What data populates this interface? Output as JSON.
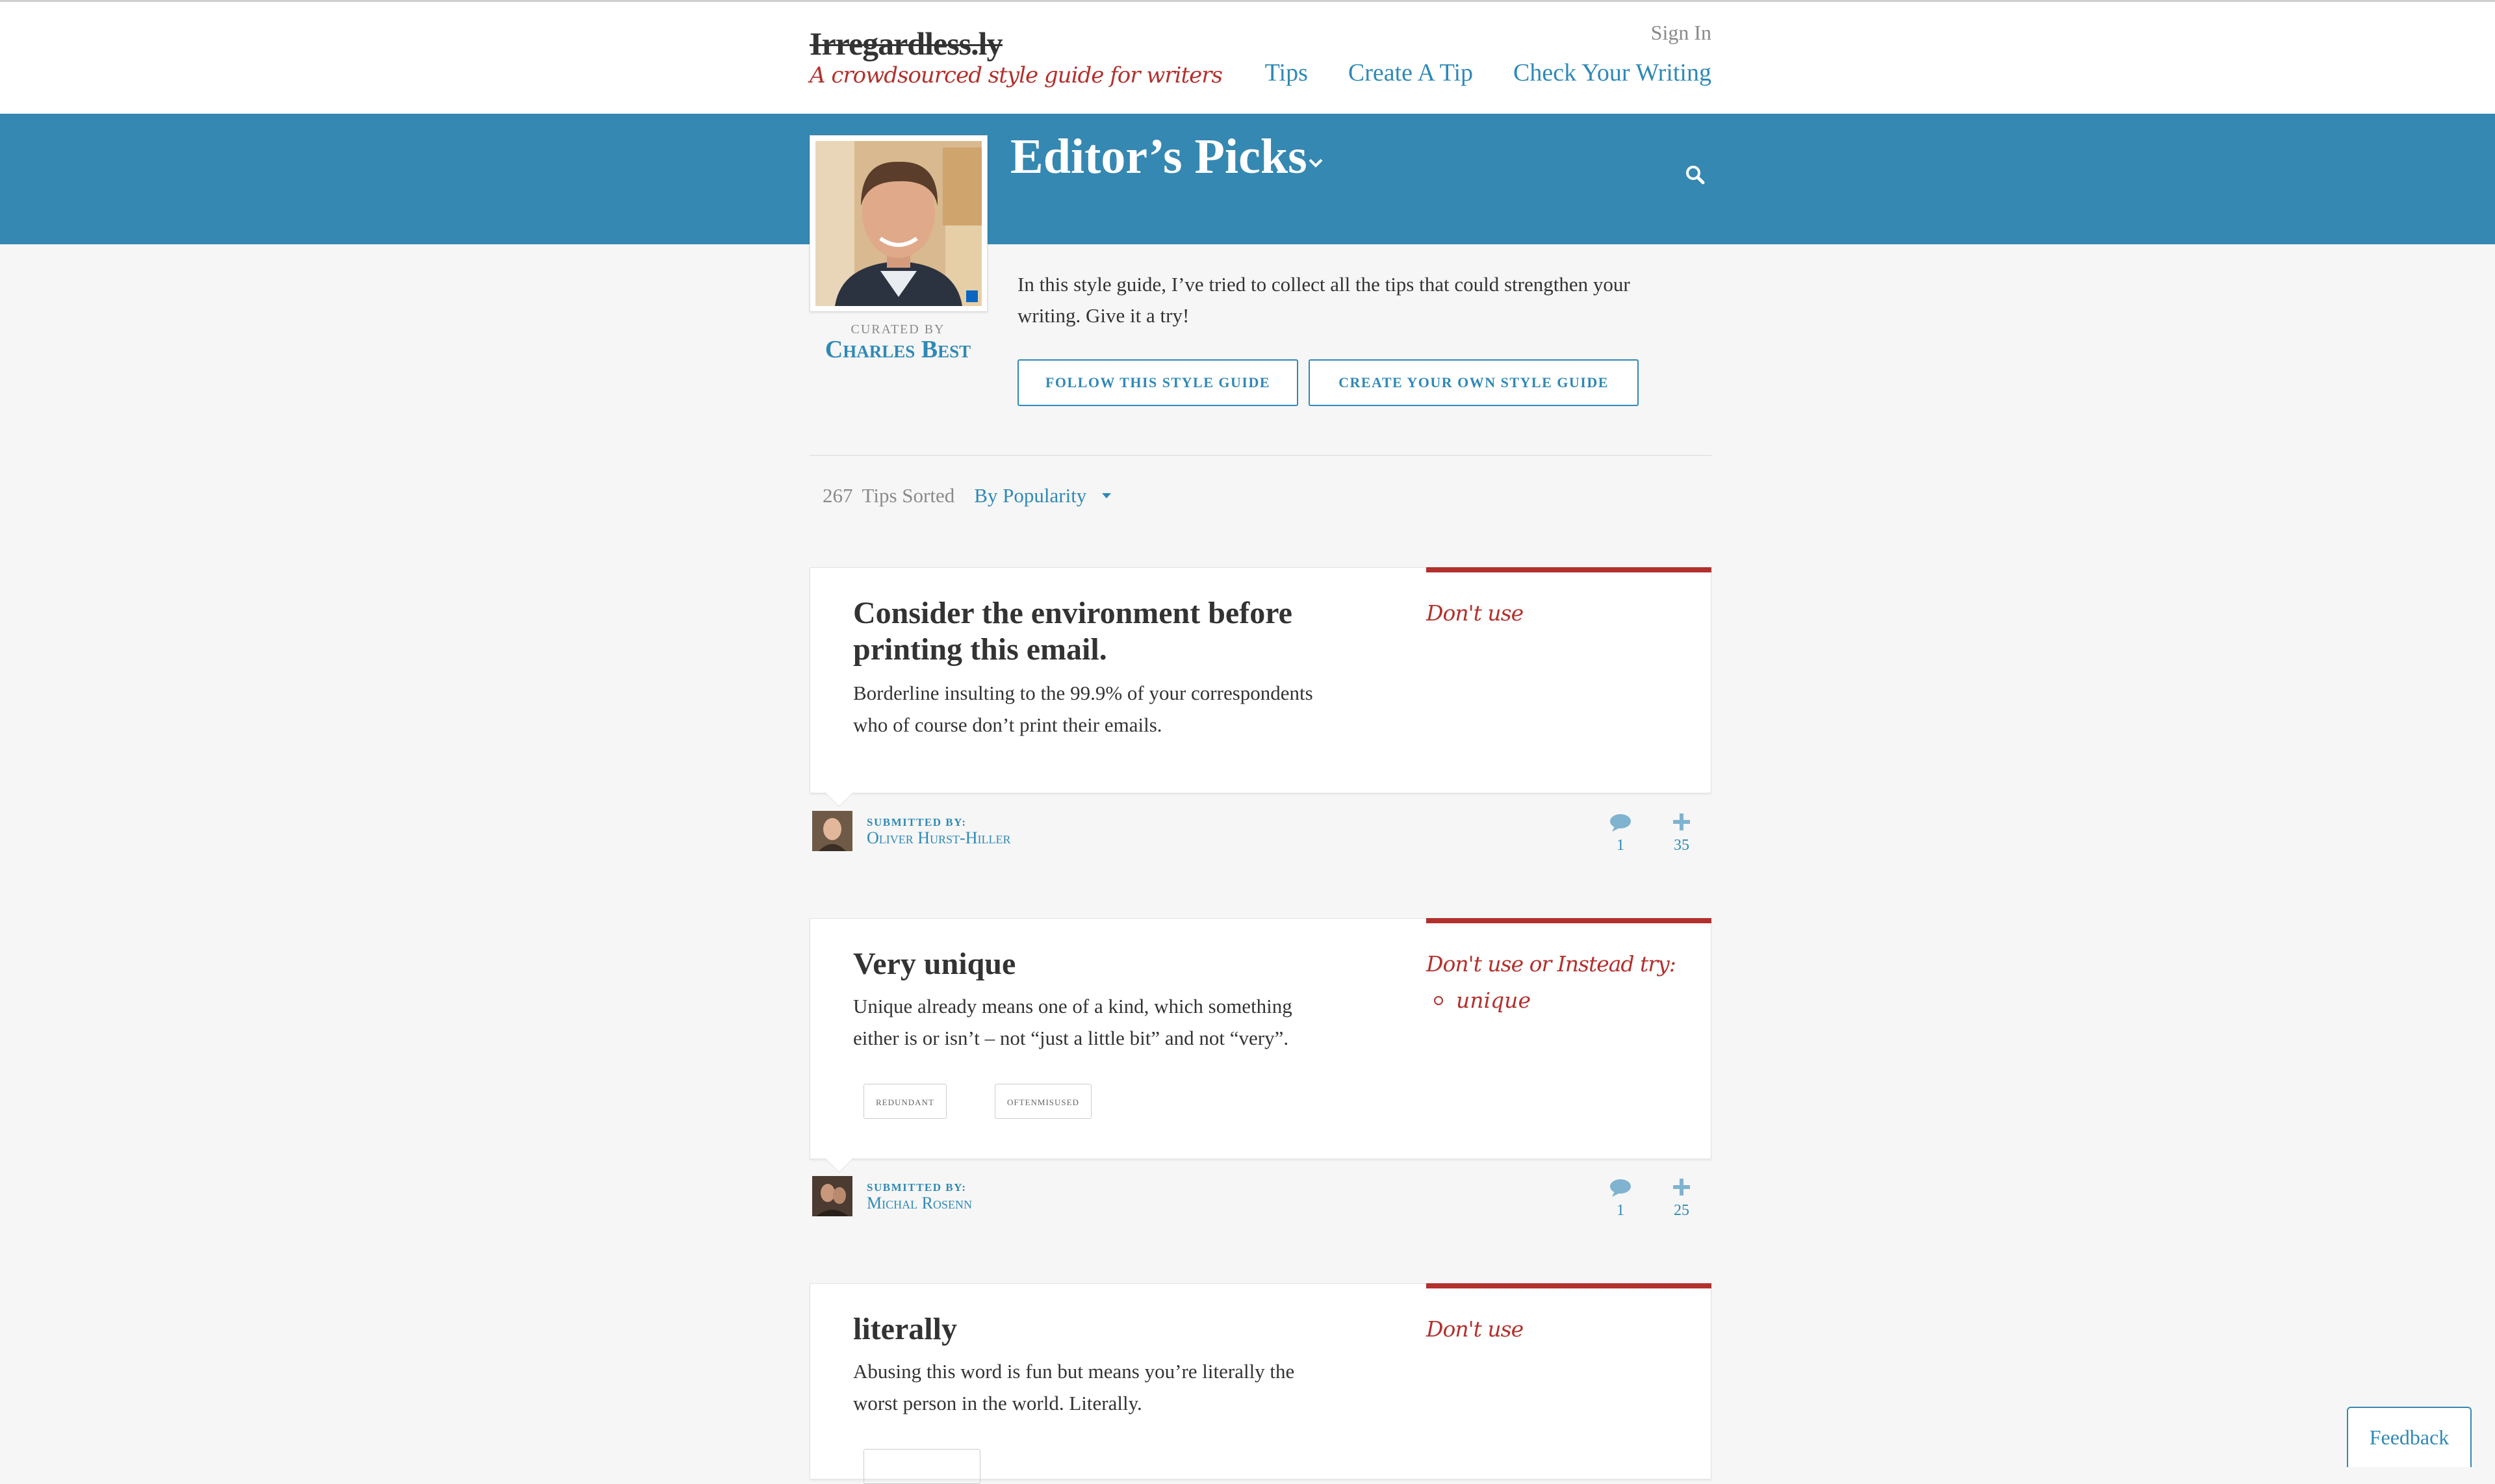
{
  "header": {
    "logo": "Irregardless.ly",
    "tagline": "A crowdsourced style guide for writers",
    "sign_in": "Sign In",
    "nav": [
      "Tips",
      "Create A Tip",
      "Check Your Writing"
    ]
  },
  "guide": {
    "title": "Editor’s Picks",
    "curated_by_label": "Curated by",
    "curator": "Charles Best",
    "intro": "In this style guide, I’ve tried to collect all the tips that could strengthen your writing. Give it a try!",
    "follow_button": "Follow this style guide",
    "create_button": "Create your own style guide"
  },
  "sort": {
    "count": "267",
    "tips_sorted": "Tips Sorted",
    "sort_by": "By Popularity"
  },
  "tips": [
    {
      "title_line1": "Consider the environment before",
      "title_line2": "printing this email.",
      "desc_line1": "Borderline insulting to the 99.9% of your correspondents",
      "desc_line2": "who of course don’t print their emails.",
      "rule": "Don't use",
      "submitted_label": "Submitted by:",
      "submitter": "Oliver Hurst-Hiller",
      "comments": "1",
      "votes": "35"
    },
    {
      "title_line1": "Very unique",
      "desc_line1": "Unique already means one of a kind, which something",
      "desc_line2": "either is or isn’t – not “just a little bit” and not “very”.",
      "rule": "Don't use or Instead try:",
      "alternative": "unique",
      "tags": [
        "redundant",
        "oftenMisused"
      ],
      "submitted_label": "Submitted by:",
      "submitter": "Michal Rosenn",
      "comments": "1",
      "votes": "25"
    },
    {
      "title_line1": "literally",
      "desc_line1": "Abusing this word is fun but means you’re literally the",
      "desc_line2": "worst person in the world. Literally.",
      "rule": "Don't use"
    }
  ],
  "feedback": "Feedback",
  "colors": {
    "accent": "#3588b1",
    "link": "#2f89b6",
    "rule_red": "#b2312d"
  }
}
